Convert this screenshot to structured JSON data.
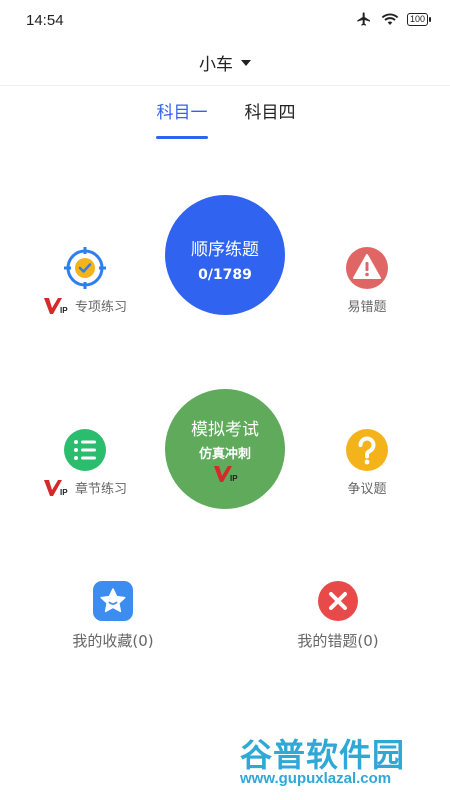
{
  "status_bar": {
    "time": "14:54",
    "battery": "100"
  },
  "header": {
    "vehicle": "小车"
  },
  "tabs": [
    {
      "label": "科目一",
      "active": true
    },
    {
      "label": "科目四",
      "active": false
    }
  ],
  "main": {
    "sequential": {
      "title": "顺序练题",
      "progress": "0/1789"
    },
    "mock": {
      "title": "模拟考试",
      "subtitle": "仿真冲刺"
    },
    "special": {
      "label": "专项练习"
    },
    "error_prone": {
      "label": "易错题"
    },
    "chapter": {
      "label": "章节练习"
    },
    "disputed": {
      "label": "争议题"
    }
  },
  "bottom": {
    "favorites": {
      "label": "我的收藏(0)"
    },
    "mistakes": {
      "label": "我的错题(0)"
    }
  },
  "watermark": {
    "title": "谷普软件园",
    "url": "www.gupuxlazal.com"
  },
  "colors": {
    "primary": "#2f63f0",
    "mock_green": "#5faa5b",
    "error_red": "#e06565",
    "question_yellow": "#f5b31b",
    "list_green": "#2bbd6e",
    "vip_red": "#d42a2a"
  }
}
